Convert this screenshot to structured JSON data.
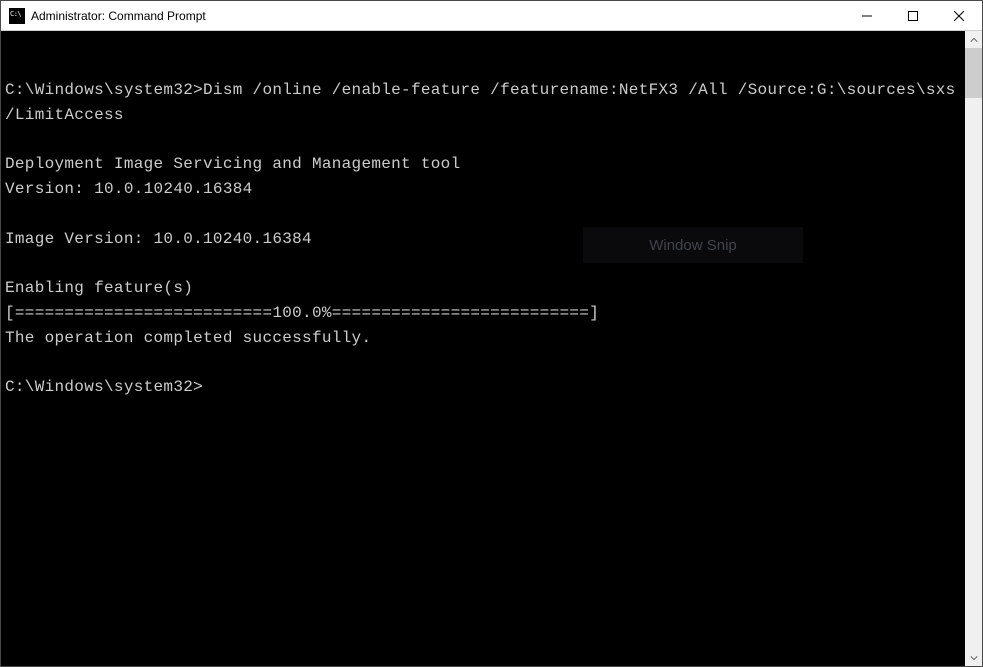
{
  "window": {
    "title": "Administrator: Command Prompt"
  },
  "terminal": {
    "lines": [
      "",
      "C:\\Windows\\system32>Dism /online /enable-feature /featurename:NetFX3 /All /Source:G:\\sources\\sxs /LimitAccess",
      "",
      "Deployment Image Servicing and Management tool",
      "Version: 10.0.10240.16384",
      "",
      "Image Version: 10.0.10240.16384",
      "",
      "Enabling feature(s)",
      "[==========================100.0%==========================]",
      "The operation completed successfully.",
      "",
      "C:\\Windows\\system32>"
    ]
  },
  "overlay": {
    "snip_label": "Window Snip"
  }
}
